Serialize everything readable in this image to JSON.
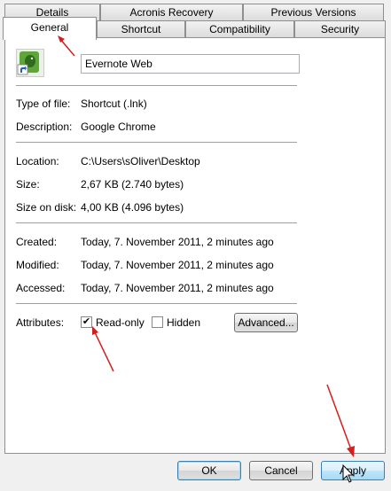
{
  "tabs": {
    "row1": [
      "Details",
      "Acronis Recovery",
      "Previous Versions"
    ],
    "row2": [
      "General",
      "Shortcut",
      "Compatibility",
      "Security"
    ]
  },
  "file": {
    "name": "Evernote Web"
  },
  "info": {
    "type_label": "Type of file:",
    "type_value": "Shortcut (.lnk)",
    "desc_label": "Description:",
    "desc_value": "Google Chrome",
    "location_label": "Location:",
    "location_value": "C:\\Users\\sOliver\\Desktop",
    "size_label": "Size:",
    "size_value": "2,67 KB (2.740 bytes)",
    "sizedisk_label": "Size on disk:",
    "sizedisk_value": "4,00 KB (4.096 bytes)",
    "created_label": "Created:",
    "created_value": "Today, 7. November 2011, 2 minutes ago",
    "modified_label": "Modified:",
    "modified_value": "Today, 7. November 2011, 2 minutes ago",
    "accessed_label": "Accessed:",
    "accessed_value": "Today, 7. November 2011, 2 minutes ago"
  },
  "attributes": {
    "label": "Attributes:",
    "readonly_label": "Read-only",
    "readonly_checked": true,
    "hidden_label": "Hidden",
    "hidden_checked": false,
    "advanced_label": "Advanced..."
  },
  "buttons": {
    "ok": "OK",
    "cancel": "Cancel",
    "apply": "Apply"
  },
  "colors": {
    "annotation_arrow": "#d22020",
    "default_button_border": "#3c7fb1"
  }
}
